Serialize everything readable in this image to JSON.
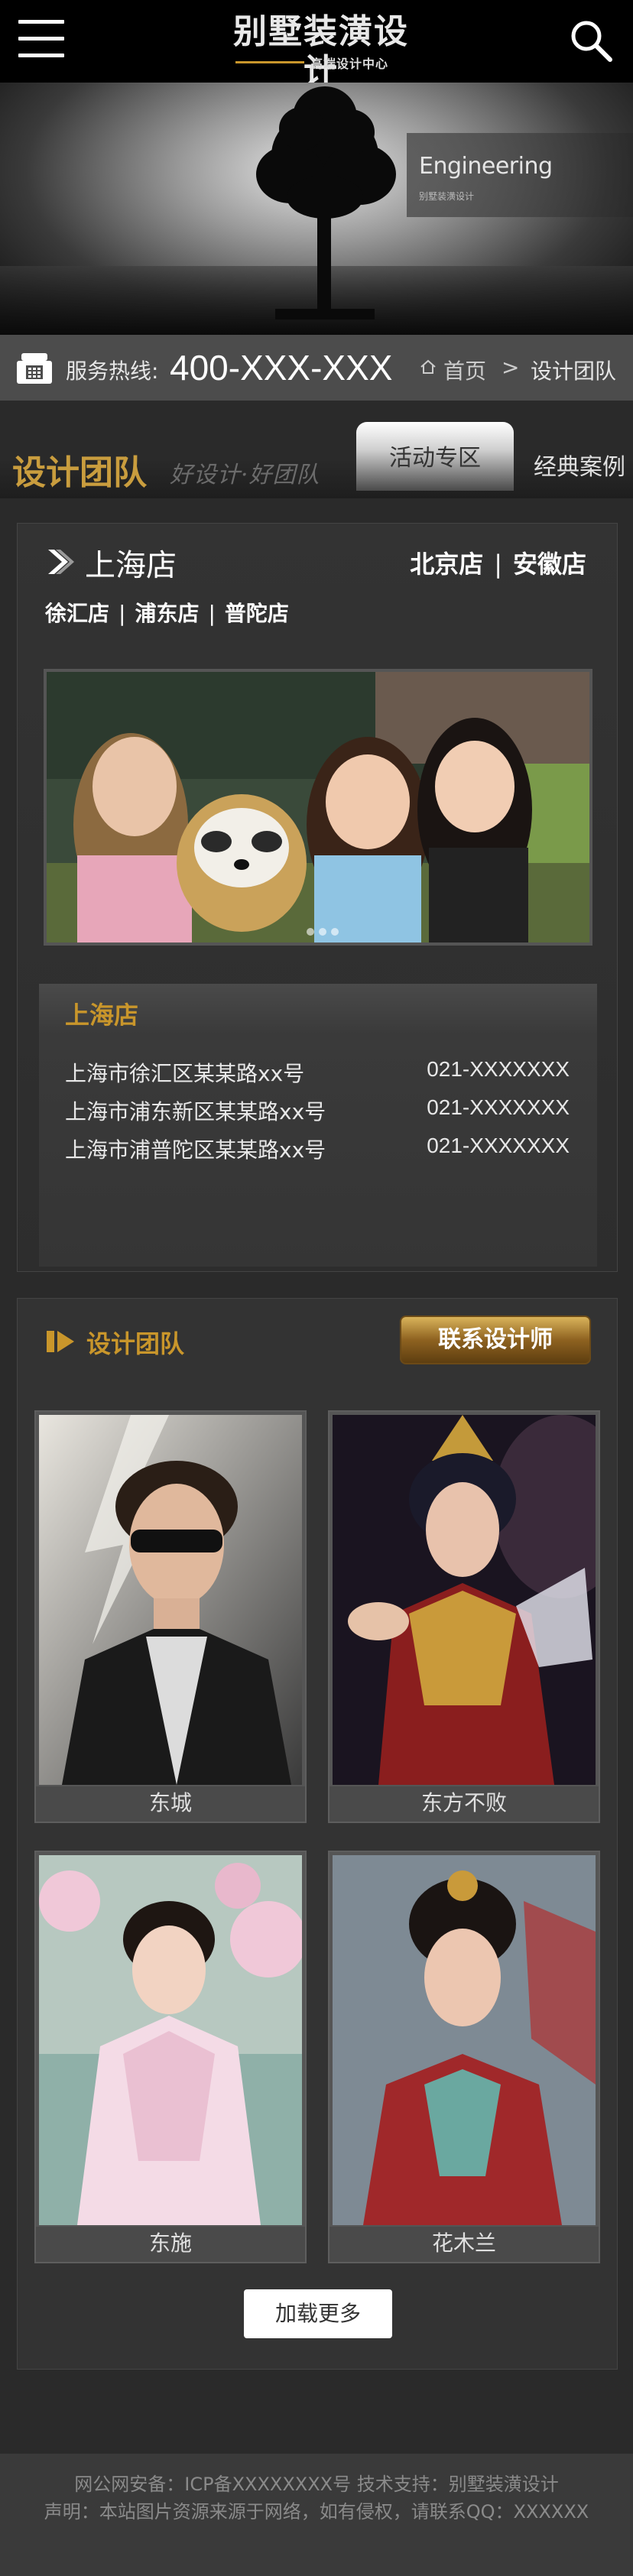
{
  "header": {
    "logo_title": "别墅装潢设计",
    "logo_subtitle": "高端设计中心",
    "menu_icon": "hamburger-menu-icon",
    "search_icon": "search-icon"
  },
  "banner": {
    "headline": "Engineering",
    "caption": "别墅装潢设计"
  },
  "hotline": {
    "label": "服务热线:",
    "number": "400-XXX-XXX",
    "breadcrumb_home": "首页",
    "breadcrumb_sep": ">",
    "breadcrumb_current": "设计团队"
  },
  "section": {
    "title": "设计团队",
    "slogan": "好设计·好团队",
    "tab_active": "活动专区",
    "tab_other": "经典案例"
  },
  "stores": {
    "current": "上海店",
    "others": [
      "北京店",
      "安徽店"
    ],
    "separator": "|",
    "branches": [
      "徐汇店",
      "浦东店",
      "普陀店"
    ],
    "address_title": "上海店",
    "addresses": [
      {
        "address": "上海市徐汇区某某路xx号",
        "phone": "021-XXXXXXX"
      },
      {
        "address": "上海市浦东新区某某路xx号",
        "phone": "021-XXXXXXX"
      },
      {
        "address": "上海市浦普陀区某某路xx号",
        "phone": "021-XXXXXXX"
      }
    ]
  },
  "designers": {
    "title": "设计团队",
    "contact_button": "联系设计师",
    "items": [
      {
        "name": "东城"
      },
      {
        "name": "东方不败"
      },
      {
        "name": "东施"
      },
      {
        "name": "花木兰"
      }
    ],
    "load_more": "加载更多"
  },
  "footer": {
    "line1": "网公网安备：ICP备XXXXXXXX号 技术支持：别墅装潢设计",
    "line2": "声明：本站图片资源来源于网络，如有侵权，请联系QQ：XXXXXX"
  },
  "colors": {
    "accent_gold": "#c9962b",
    "background": "#2a2a2a"
  }
}
